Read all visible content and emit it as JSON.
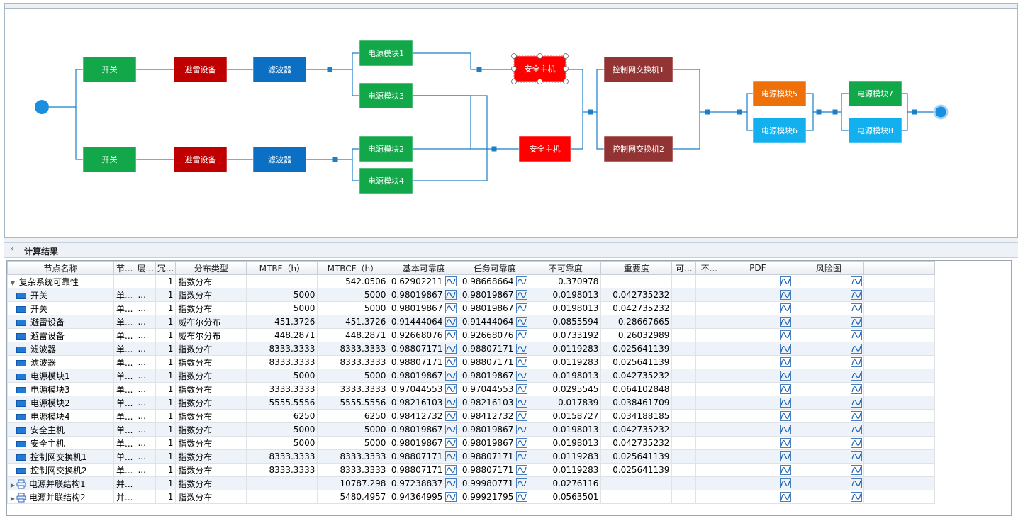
{
  "diagram": {
    "nodes": [
      {
        "id": "kg1",
        "label": "开关",
        "color": "#12a84a"
      },
      {
        "id": "bl1",
        "label": "避雷设备",
        "color": "#c00000"
      },
      {
        "id": "lb1",
        "label": "滤波器",
        "color": "#0b6fc3"
      },
      {
        "id": "kg2",
        "label": "开关",
        "color": "#12a84a"
      },
      {
        "id": "bl2",
        "label": "避雷设备",
        "color": "#c00000"
      },
      {
        "id": "lb2",
        "label": "滤波器",
        "color": "#0b6fc3"
      },
      {
        "id": "dy1",
        "label": "电源模块1",
        "color": "#12a84a"
      },
      {
        "id": "dy3",
        "label": "电源模块3",
        "color": "#12a84a"
      },
      {
        "id": "dy2",
        "label": "电源模块2",
        "color": "#12a84a"
      },
      {
        "id": "dy4",
        "label": "电源模块4",
        "color": "#12a84a"
      },
      {
        "id": "aq1",
        "label": "安全主机",
        "color": "#ff0000"
      },
      {
        "id": "aq2",
        "label": "安全主机",
        "color": "#ff0000"
      },
      {
        "id": "jh1",
        "label": "控制网交换机1",
        "color": "#933434"
      },
      {
        "id": "jh2",
        "label": "控制网交换机2",
        "color": "#933434"
      },
      {
        "id": "dy5",
        "label": "电源模块5",
        "color": "#ee7008"
      },
      {
        "id": "dy6",
        "label": "电源模块6",
        "color": "#12b0ee"
      },
      {
        "id": "dy7",
        "label": "电源模块7",
        "color": "#12a84a"
      },
      {
        "id": "dy8",
        "label": "电源模块8",
        "color": "#12b0ee"
      }
    ],
    "line_color": "#1a7fc8"
  },
  "panel": {
    "title": "计算结果"
  },
  "table": {
    "columns": [
      "节点名称",
      "节...",
      "层...",
      "冗...",
      "分布类型",
      "MTBF（h）",
      "MTBCF（h）",
      "基本可靠度",
      "任务可靠度",
      "不可靠度",
      "重要度",
      "可...",
      "不...",
      "PDF",
      "风险图"
    ],
    "rows": [
      {
        "name": "复杂系统可靠性",
        "icon": "root",
        "c2": "",
        "c3": "",
        "c4": "1",
        "dist": "指数分布",
        "mtbf": "",
        "mtbcf": "542.0506",
        "basic": "0.62902211",
        "task": "0.98668664",
        "unrel": "0.370978",
        "imp": ""
      },
      {
        "name": "开关",
        "icon": "rect",
        "c2": "单...",
        "c3": "...",
        "c4": "1",
        "dist": "指数分布",
        "mtbf": "5000",
        "mtbcf": "5000",
        "basic": "0.98019867",
        "task": "0.98019867",
        "unrel": "0.0198013",
        "imp": "0.042735232"
      },
      {
        "name": "开关",
        "icon": "rect",
        "c2": "单...",
        "c3": "...",
        "c4": "1",
        "dist": "指数分布",
        "mtbf": "5000",
        "mtbcf": "5000",
        "basic": "0.98019867",
        "task": "0.98019867",
        "unrel": "0.0198013",
        "imp": "0.042735232"
      },
      {
        "name": "避雷设备",
        "icon": "rect",
        "c2": "单...",
        "c3": "...",
        "c4": "1",
        "dist": "威布尔分布",
        "mtbf": "451.3726",
        "mtbcf": "451.3726",
        "basic": "0.91444064",
        "task": "0.91444064",
        "unrel": "0.0855594",
        "imp": "0.28667665"
      },
      {
        "name": "避雷设备",
        "icon": "rect",
        "c2": "单...",
        "c3": "...",
        "c4": "1",
        "dist": "威布尔分布",
        "mtbf": "448.2871",
        "mtbcf": "448.2871",
        "basic": "0.92668076",
        "task": "0.92668076",
        "unrel": "0.0733192",
        "imp": "0.26032989"
      },
      {
        "name": "滤波器",
        "icon": "rect",
        "c2": "单...",
        "c3": "...",
        "c4": "1",
        "dist": "指数分布",
        "mtbf": "8333.3333",
        "mtbcf": "8333.3333",
        "basic": "0.98807171",
        "task": "0.98807171",
        "unrel": "0.0119283",
        "imp": "0.025641139"
      },
      {
        "name": "滤波器",
        "icon": "rect",
        "c2": "单...",
        "c3": "...",
        "c4": "1",
        "dist": "指数分布",
        "mtbf": "8333.3333",
        "mtbcf": "8333.3333",
        "basic": "0.98807171",
        "task": "0.98807171",
        "unrel": "0.0119283",
        "imp": "0.025641139"
      },
      {
        "name": "电源模块1",
        "icon": "rect",
        "c2": "单...",
        "c3": "...",
        "c4": "1",
        "dist": "指数分布",
        "mtbf": "5000",
        "mtbcf": "5000",
        "basic": "0.98019867",
        "task": "0.98019867",
        "unrel": "0.0198013",
        "imp": "0.042735232"
      },
      {
        "name": "电源模块3",
        "icon": "rect",
        "c2": "单...",
        "c3": "...",
        "c4": "1",
        "dist": "指数分布",
        "mtbf": "3333.3333",
        "mtbcf": "3333.3333",
        "basic": "0.97044553",
        "task": "0.97044553",
        "unrel": "0.0295545",
        "imp": "0.064102848"
      },
      {
        "name": "电源模块2",
        "icon": "rect",
        "c2": "单...",
        "c3": "...",
        "c4": "1",
        "dist": "指数分布",
        "mtbf": "5555.5556",
        "mtbcf": "5555.5556",
        "basic": "0.98216103",
        "task": "0.98216103",
        "unrel": "0.017839",
        "imp": "0.038461709"
      },
      {
        "name": "电源模块4",
        "icon": "rect",
        "c2": "单...",
        "c3": "...",
        "c4": "1",
        "dist": "指数分布",
        "mtbf": "6250",
        "mtbcf": "6250",
        "basic": "0.98412732",
        "task": "0.98412732",
        "unrel": "0.0158727",
        "imp": "0.034188185"
      },
      {
        "name": "安全主机",
        "icon": "rect",
        "c2": "单...",
        "c3": "...",
        "c4": "1",
        "dist": "指数分布",
        "mtbf": "5000",
        "mtbcf": "5000",
        "basic": "0.98019867",
        "task": "0.98019867",
        "unrel": "0.0198013",
        "imp": "0.042735232"
      },
      {
        "name": "安全主机",
        "icon": "rect",
        "c2": "单...",
        "c3": "...",
        "c4": "1",
        "dist": "指数分布",
        "mtbf": "5000",
        "mtbcf": "5000",
        "basic": "0.98019867",
        "task": "0.98019867",
        "unrel": "0.0198013",
        "imp": "0.042735232"
      },
      {
        "name": "控制网交换机1",
        "icon": "rect",
        "c2": "单...",
        "c3": "...",
        "c4": "1",
        "dist": "指数分布",
        "mtbf": "8333.3333",
        "mtbcf": "8333.3333",
        "basic": "0.98807171",
        "task": "0.98807171",
        "unrel": "0.0119283",
        "imp": "0.025641139"
      },
      {
        "name": "控制网交换机2",
        "icon": "rect",
        "c2": "单...",
        "c3": "...",
        "c4": "1",
        "dist": "指数分布",
        "mtbf": "8333.3333",
        "mtbcf": "8333.3333",
        "basic": "0.98807171",
        "task": "0.98807171",
        "unrel": "0.0119283",
        "imp": "0.025641139"
      },
      {
        "name": "电源并联结构1",
        "icon": "printer",
        "c2": "并...",
        "c3": "",
        "c4": "1",
        "dist": "指数分布",
        "mtbf": "",
        "mtbcf": "10787.298",
        "basic": "0.97238837",
        "task": "0.99980771",
        "unrel": "0.0276116",
        "imp": ""
      },
      {
        "name": "电源并联结构2",
        "icon": "printer",
        "c2": "并...",
        "c3": "",
        "c4": "1",
        "dist": "指数分布",
        "mtbf": "",
        "mtbcf": "5480.4957",
        "basic": "0.94364995",
        "task": "0.99921795",
        "unrel": "0.0563501",
        "imp": ""
      }
    ]
  }
}
